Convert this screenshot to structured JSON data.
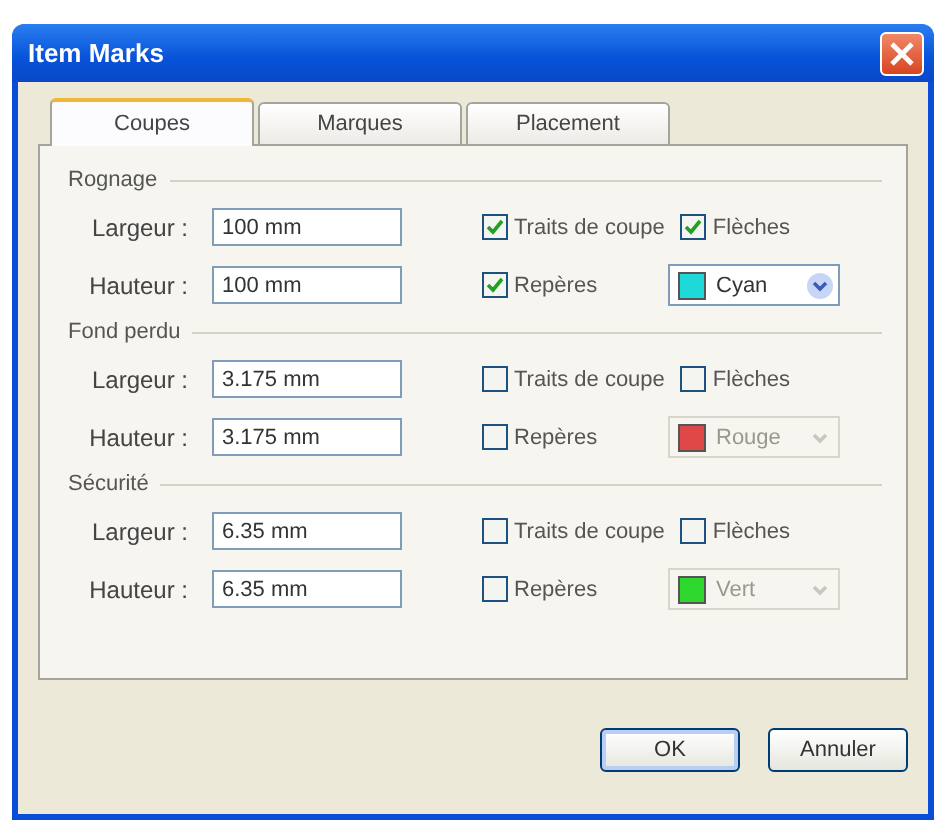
{
  "window": {
    "title": "Item Marks"
  },
  "tabs": [
    {
      "label": "Coupes",
      "selected": true
    },
    {
      "label": "Marques",
      "selected": false
    },
    {
      "label": "Placement",
      "selected": false
    }
  ],
  "sections": [
    {
      "title": "Rognage",
      "rows": [
        {
          "label": "Largeur :",
          "value": "100 mm"
        },
        {
          "label": "Hauteur :",
          "value": "100 mm"
        }
      ],
      "crop_marks": {
        "label": "Traits de coupe",
        "checked": true
      },
      "arrows": {
        "label": "Flèches",
        "checked": true
      },
      "registration": {
        "label": "Repères",
        "checked": true
      },
      "color_select": {
        "value": "Cyan",
        "color": "#1fd8d8",
        "disabled": false
      }
    },
    {
      "title": "Fond perdu",
      "rows": [
        {
          "label": "Largeur :",
          "value": "3.175 mm"
        },
        {
          "label": "Hauteur :",
          "value": "3.175 mm"
        }
      ],
      "crop_marks": {
        "label": "Traits de coupe",
        "checked": false
      },
      "arrows": {
        "label": "Flèches",
        "checked": false
      },
      "registration": {
        "label": "Repères",
        "checked": false
      },
      "color_select": {
        "value": "Rouge",
        "color": "#e04848",
        "disabled": true
      }
    },
    {
      "title": "Sécurité",
      "rows": [
        {
          "label": "Largeur :",
          "value": "6.35 mm"
        },
        {
          "label": "Hauteur :",
          "value": "6.35 mm"
        }
      ],
      "crop_marks": {
        "label": "Traits de coupe",
        "checked": false
      },
      "arrows": {
        "label": "Flèches",
        "checked": false
      },
      "registration": {
        "label": "Repères",
        "checked": false
      },
      "color_select": {
        "value": "Vert",
        "color": "#2ed82e",
        "disabled": true
      }
    }
  ],
  "buttons": [
    {
      "label": "OK"
    },
    {
      "label": "Annuler"
    }
  ]
}
